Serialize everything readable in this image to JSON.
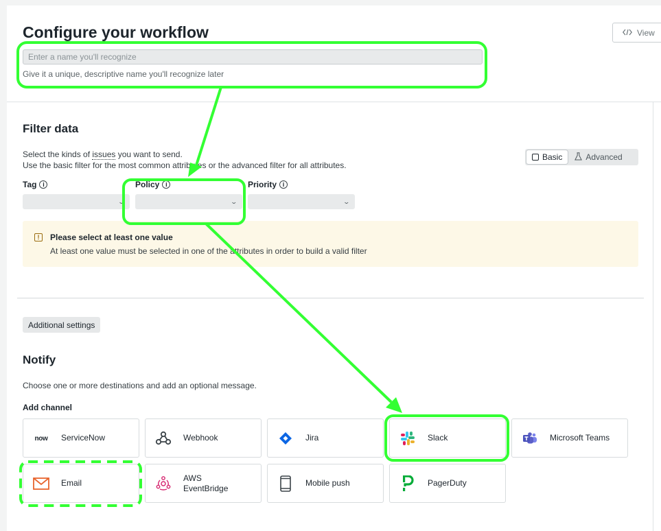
{
  "page": {
    "title": "Configure your workflow",
    "view_button": "View"
  },
  "name_field": {
    "value": "",
    "placeholder": "Enter a name you'll recognize",
    "helper": "Give it a unique, descriptive name you'll recognize later"
  },
  "filter": {
    "heading": "Filter data",
    "desc_line1_prefix": "Select the kinds of ",
    "desc_line1_link": "issues",
    "desc_line1_suffix": " you want to send.",
    "desc_line2": "Use the basic filter for the most common attributes or the advanced filter for all attributes.",
    "toggle": {
      "basic": "Basic",
      "advanced": "Advanced",
      "selected": "Basic"
    },
    "fields": [
      {
        "label": "Tag",
        "value": ""
      },
      {
        "label": "Policy",
        "value": ""
      },
      {
        "label": "Priority",
        "value": ""
      }
    ],
    "warning": {
      "title": "Please select at least one value",
      "text": "At least one value must be selected in one of the attributes in order to build a valid filter"
    }
  },
  "additional_settings": "Additional settings",
  "notify": {
    "heading": "Notify",
    "desc": "Choose one or more destinations and add an optional message.",
    "add_channel": "Add channel",
    "channels": [
      {
        "label": "ServiceNow",
        "icon": "servicenow-logo-icon",
        "logo_text": "now"
      },
      {
        "label": "Webhook",
        "icon": "webhook-icon"
      },
      {
        "label": "Jira",
        "icon": "jira-icon"
      },
      {
        "label": "Slack",
        "icon": "slack-icon"
      },
      {
        "label": "Microsoft Teams",
        "icon": "microsoft-teams-icon"
      },
      {
        "label": "Email",
        "icon": "email-icon"
      },
      {
        "label": "AWS EventBridge",
        "icon": "aws-eventbridge-icon"
      },
      {
        "label": "Mobile push",
        "icon": "mobile-push-icon"
      },
      {
        "label": "PagerDuty",
        "icon": "pagerduty-icon"
      }
    ]
  },
  "colors": {
    "annotation": "#33ff33",
    "email_orange": "#e8642d",
    "jira_blue": "#0c66e4",
    "pagerduty_green": "#06ac38",
    "teams_purple": "#5b5fc7",
    "eventbridge_pink": "#d6246e"
  }
}
